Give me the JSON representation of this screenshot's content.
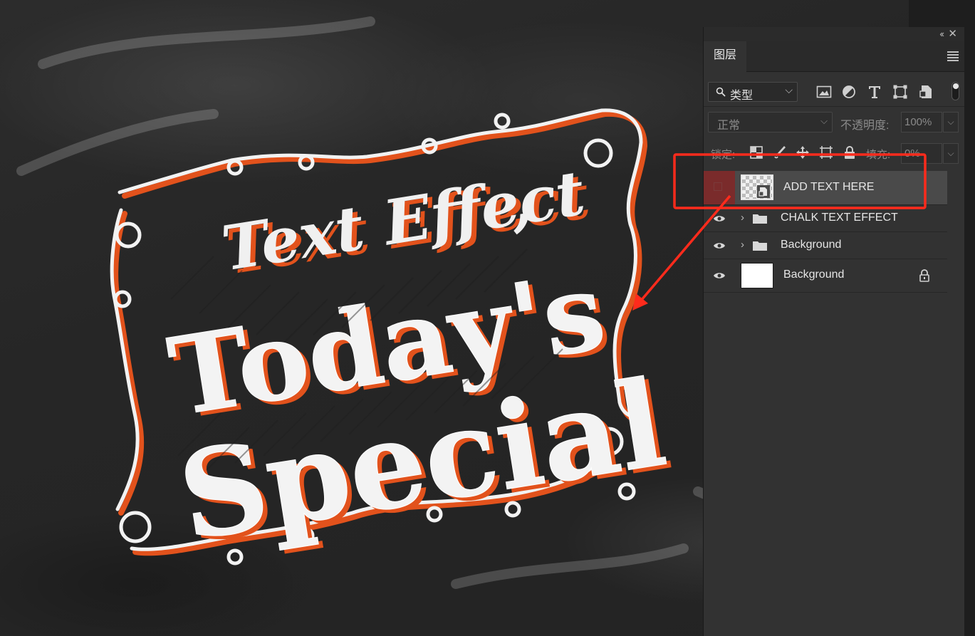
{
  "canvas": {
    "line1": "Text Effect",
    "line1_comma": ",",
    "line2": "Today's",
    "line3": "Special",
    "colors": {
      "board": "#262626",
      "chalk": "#f3f3f3",
      "accent": "#e2521c"
    }
  },
  "panel": {
    "collapse_icon": "‹‹",
    "close_icon": "✕",
    "tab_label": "图层",
    "filter": {
      "label": "类型",
      "chevron": "⌵",
      "icons": [
        "image-filter-icon",
        "adjustment-filter-icon",
        "type-filter-icon",
        "shape-filter-icon",
        "smart-object-filter-icon"
      ]
    },
    "blend_mode": "正常",
    "opacity_label": "不透明度:",
    "opacity_value": "100%",
    "lock_label": "锁定:",
    "fill_label": "填充:",
    "fill_value": "0%",
    "layers": [
      {
        "name": "ADD TEXT HERE",
        "kind": "smart-object",
        "visible": false,
        "selected": true
      },
      {
        "name": "CHALK TEXT EFFECT",
        "kind": "group",
        "visible": true,
        "selected": false
      },
      {
        "name": "Background",
        "kind": "group",
        "visible": true,
        "selected": false
      },
      {
        "name": "Background",
        "kind": "layer",
        "visible": true,
        "selected": false,
        "locked": true
      }
    ]
  },
  "annotation_color": "#ff2b1c"
}
